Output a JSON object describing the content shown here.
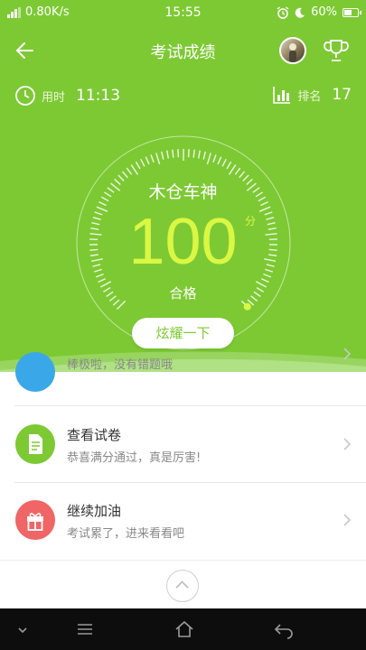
{
  "status_bar": {
    "network_speed": "0.80K/s",
    "time": "15:55",
    "battery": "60%",
    "battery_level": 0.6,
    "network_type": "4G"
  },
  "header": {
    "title": "考试成绩"
  },
  "stats": {
    "time_label": "用时",
    "time_value": "11:13",
    "rank_label": "排名",
    "rank_value": "17"
  },
  "result": {
    "car_name": "木仓车神",
    "score": "100",
    "score_unit": "分",
    "score_fraction": 1.0,
    "pass_text": "合格",
    "share_label": "炫耀一下"
  },
  "list": {
    "items": [
      {
        "title": "",
        "subtitle": "棒极啦，没有错题哦",
        "icon": "error-book-icon",
        "color": "#3aa8e8"
      },
      {
        "title": "查看试卷",
        "subtitle": "恭喜满分通过，真是厉害!",
        "icon": "document-icon",
        "color": "#7dc934"
      },
      {
        "title": "继续加油",
        "subtitle": "考试累了，进来看看吧",
        "icon": "gift-icon",
        "color": "#f06565"
      }
    ]
  },
  "colors": {
    "accent": "#7dc934",
    "score": "#d9f743"
  }
}
